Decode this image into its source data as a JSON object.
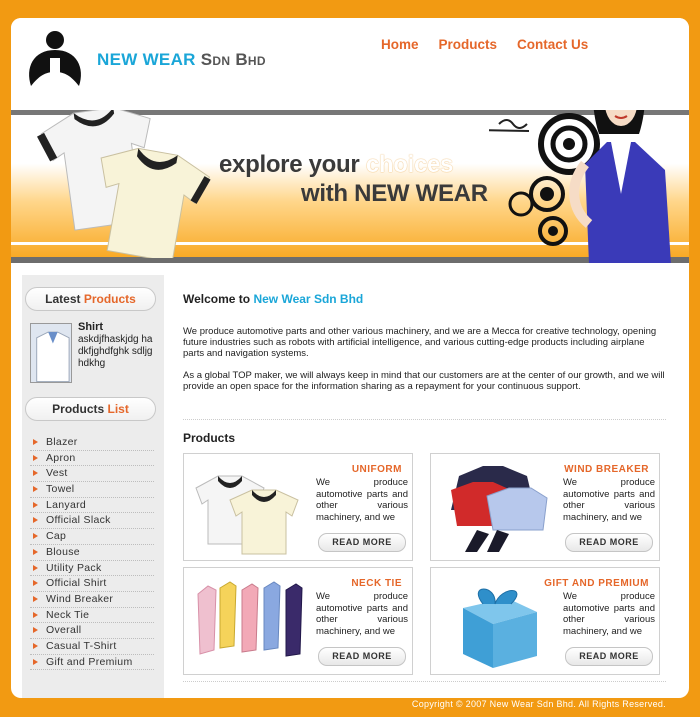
{
  "brand": {
    "name_part1": "NEW WEAR",
    "name_part2": "Sdn Bhd"
  },
  "nav": {
    "items": [
      "Home",
      "Products",
      "Contact Us"
    ]
  },
  "banner": {
    "line1_a": "explore your ",
    "line1_b": "choices",
    "line2": "with NEW WEAR"
  },
  "sidebar": {
    "latest_head_a": "Latest ",
    "latest_head_b": "Products",
    "latest_name": "Shirt",
    "latest_desc": "askdjfhaskjdg hadkfjghdfghk sdljghdkhg",
    "list_head_a": "Products ",
    "list_head_b": "List",
    "items": [
      "Blazer",
      "Apron",
      "Vest",
      "Towel",
      "Lanyard",
      "Official Slack",
      "Cap",
      "Blouse",
      "Utility Pack",
      "Official Shirt",
      "Wind Breaker",
      "Neck Tie",
      "Overall",
      "Casual T-Shirt",
      "Gift and Premium"
    ]
  },
  "content": {
    "welcome_a": "Welcome to ",
    "welcome_b": "New Wear Sdn Bhd",
    "para1": "We produce automotive parts and other various machinery, and we are a Mecca for creative technology, opening future industries such as robots with artificial intelligence, and various cutting-edge products including airplane parts and navigation systems.",
    "para2": "As a global TOP maker, we will always keep in mind that our customers are at the center of our growth, and we will provide an open space for the information sharing as a repayment for your continuous support.",
    "products_title": "Products",
    "cards": [
      {
        "title": "UNIFORM",
        "text": "We produce automotive parts and other various machinery, and we",
        "button": "READ MORE"
      },
      {
        "title": "WIND BREAKER",
        "text": "We produce automotive parts and other various machinery, and we",
        "button": "READ MORE"
      },
      {
        "title": "NECK TIE",
        "text": "We produce automotive parts and other various machinery, and we",
        "button": "READ MORE"
      },
      {
        "title": "GIFT AND PREMIUM",
        "text": "We produce automotive parts and other various machinery, and we",
        "button": "READ MORE"
      }
    ]
  },
  "footer": {
    "copyright": "Copyright © 2007 New Wear Sdn Bhd. All Rights Reserved."
  },
  "colors": {
    "accent_orange": "#e5672a",
    "brand_blue": "#1aa6d8",
    "frame_orange": "#f29a12"
  }
}
